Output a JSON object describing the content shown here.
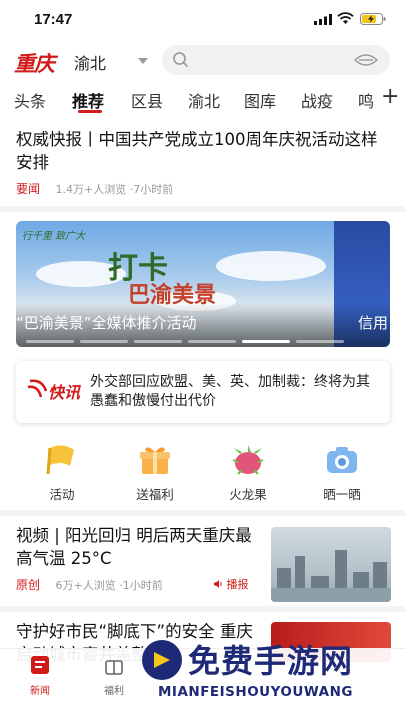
{
  "status_bar": {
    "time": "17:47"
  },
  "header": {
    "logo": "重庆",
    "district": "渝北"
  },
  "tabs": [
    "头条",
    "推荐",
    "区县",
    "渝北",
    "图库",
    "战疫",
    "鸣"
  ],
  "active_tab": "推荐",
  "news": [
    {
      "title": "权威快报丨中国共产党成立100周年庆祝活动这样安排",
      "tag": "要闻",
      "meta": "1.4万+人浏览 ·7小时前"
    },
    {
      "title": "视频 | 阳光回归 明后两天重庆最高气温 25°C",
      "tag": "原创",
      "meta": "6万+人浏览 ·1小时前",
      "action": "播报"
    },
    {
      "title": "守护好市民“脚底下”的安全 重庆启动城市窨井盖整治"
    }
  ],
  "banner": {
    "caption": "“巴渝美景”全媒体推介活动",
    "caption_right": "信用",
    "headline_1": "打卡",
    "headline_2": "巴渝美景",
    "slogan": "行千里 致广大",
    "slide_total": 6,
    "slide_active": 5
  },
  "flash": {
    "badge": "快讯",
    "text": "外交部回应欧盟、美、英、加制裁：终将为其愚蠢和傲慢付出代价"
  },
  "quick_icons": [
    {
      "label": "活动",
      "icon": "flag-icon"
    },
    {
      "label": "送福利",
      "icon": "gift-icon"
    },
    {
      "label": "火龙果",
      "icon": "dragon-fruit-icon"
    },
    {
      "label": "晒一晒",
      "icon": "camera-icon"
    }
  ],
  "bottom_nav": [
    {
      "label": "新闻",
      "icon": "news-icon",
      "active": true
    },
    {
      "label": "福利",
      "icon": "gift-icon"
    }
  ],
  "watermark": {
    "cn": "免费手游网",
    "en": "MIANFEISHOUYOUWANG"
  },
  "colors": {
    "accent": "#d11a1a",
    "watermark": "#1e2a78"
  }
}
